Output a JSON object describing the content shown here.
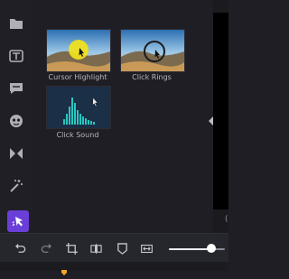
{
  "sidebar": {
    "items": [
      {
        "icon": "folder-icon"
      },
      {
        "icon": "text-icon"
      },
      {
        "icon": "comment-icon"
      },
      {
        "icon": "sticker-icon"
      },
      {
        "icon": "transition-icon"
      },
      {
        "icon": "magic-wand-icon"
      },
      {
        "icon": "cursor-effects-icon",
        "active": true
      }
    ],
    "active_color": "#6a3fd8"
  },
  "effects": [
    {
      "label": "Cursor Highlight"
    },
    {
      "label": "Click Rings"
    },
    {
      "label": "Click Sound"
    }
  ],
  "preview": {
    "partial_text": "("
  },
  "toolbar": {
    "tools": [
      "undo-icon",
      "redo-icon",
      "crop-icon",
      "split-icon",
      "marker-icon",
      "fit-width-icon"
    ],
    "zoom_level": 0.75
  },
  "colors": {
    "accent": "#6a3fd8",
    "waveform": "#27c7c0",
    "playhead": "#f5a623"
  }
}
